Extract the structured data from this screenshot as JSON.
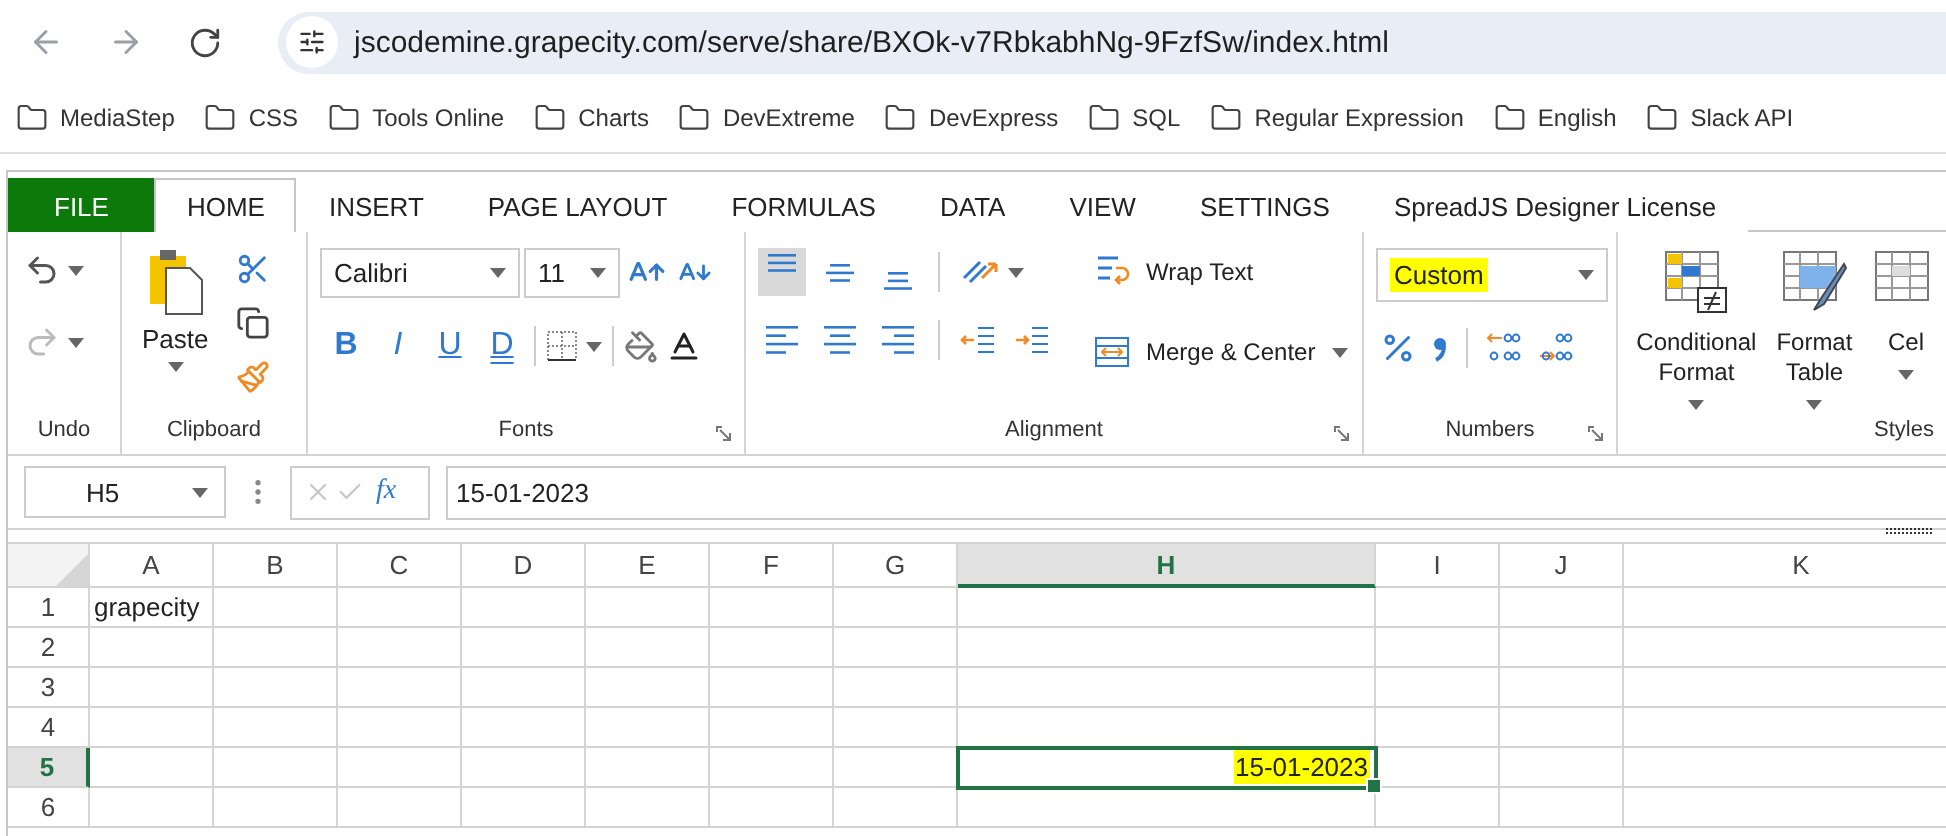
{
  "browser": {
    "url": "jscodemine.grapecity.com/serve/share/BXOk-v7RbkabhNg-9FzfSw/index.html",
    "bookmarks": [
      "MediaStep",
      "CSS",
      "Tools Online",
      "Charts",
      "DevExtreme",
      "DevExpress",
      "SQL",
      "Regular Expression",
      "English",
      "Slack API"
    ]
  },
  "ribbon": {
    "tabs": [
      {
        "label": "FILE",
        "kind": "file",
        "selected": false
      },
      {
        "label": "HOME",
        "kind": "tab",
        "selected": true
      },
      {
        "label": "INSERT",
        "kind": "tab",
        "selected": false
      },
      {
        "label": "PAGE LAYOUT",
        "kind": "tab",
        "selected": false
      },
      {
        "label": "FORMULAS",
        "kind": "tab",
        "selected": false
      },
      {
        "label": "DATA",
        "kind": "tab",
        "selected": false
      },
      {
        "label": "VIEW",
        "kind": "tab",
        "selected": false
      },
      {
        "label": "SETTINGS",
        "kind": "tab",
        "selected": false
      },
      {
        "label": "SpreadJS Designer License",
        "kind": "tab",
        "selected": false
      }
    ],
    "undo": {
      "label": "Undo",
      "buttons": [
        {
          "kind": "undo",
          "disabled": false
        },
        {
          "kind": "redo",
          "disabled": true
        }
      ]
    },
    "clipboard": {
      "label": "Clipboard",
      "paste": "Paste"
    },
    "fonts": {
      "label": "Fonts",
      "font": "Calibri",
      "size": "11",
      "styles": [
        "B",
        "I",
        "U",
        "D"
      ]
    },
    "alignment": {
      "label": "Alignment",
      "vertical": [
        {
          "kind": "top",
          "selected": true
        },
        {
          "kind": "middle",
          "selected": false
        },
        {
          "kind": "bottom",
          "selected": false
        }
      ],
      "horizontal": [
        {
          "kind": "left",
          "selected": false
        },
        {
          "kind": "center",
          "selected": false
        },
        {
          "kind": "right",
          "selected": false
        }
      ],
      "wrap_text": "Wrap Text",
      "merge": "Merge & Center"
    },
    "numbers": {
      "label": "Numbers",
      "format": "Custom",
      "highlighted": true
    },
    "styles": {
      "label": "Styles",
      "buttons": [
        {
          "kind": "conditional",
          "label": "Conditional Format"
        },
        {
          "kind": "table",
          "label": "Format Table"
        },
        {
          "kind": "cell",
          "label": "Cel"
        }
      ]
    }
  },
  "formula_bar": {
    "name_box": "H5",
    "fx": "fx",
    "value": "15-01-2023"
  },
  "sheet": {
    "columns": [
      {
        "label": "A",
        "selected": false
      },
      {
        "label": "B",
        "selected": false
      },
      {
        "label": "C",
        "selected": false
      },
      {
        "label": "D",
        "selected": false
      },
      {
        "label": "E",
        "selected": false
      },
      {
        "label": "F",
        "selected": false
      },
      {
        "label": "G",
        "selected": false
      },
      {
        "label": "H",
        "selected": true
      },
      {
        "label": "I",
        "selected": false
      },
      {
        "label": "J",
        "selected": false
      },
      {
        "label": "K",
        "selected": false
      }
    ],
    "rows": [
      {
        "label": "1",
        "selected": false,
        "cells": [
          {
            "text": "grapecity"
          },
          {},
          {},
          {},
          {},
          {},
          {},
          {},
          {},
          {},
          {}
        ]
      },
      {
        "label": "2",
        "selected": false,
        "cells": [
          {},
          {},
          {},
          {},
          {},
          {},
          {},
          {},
          {},
          {},
          {}
        ]
      },
      {
        "label": "3",
        "selected": false,
        "cells": [
          {},
          {},
          {},
          {},
          {},
          {},
          {},
          {},
          {},
          {},
          {}
        ]
      },
      {
        "label": "4",
        "selected": false,
        "cells": [
          {},
          {},
          {},
          {},
          {},
          {},
          {},
          {},
          {},
          {},
          {}
        ]
      },
      {
        "label": "5",
        "selected": true,
        "cells": [
          {},
          {},
          {},
          {},
          {},
          {},
          {},
          {
            "text": "15-01-2023",
            "kind": "date",
            "highlighted": true
          },
          {},
          {},
          {}
        ]
      },
      {
        "label": "6",
        "selected": false,
        "cells": [
          {},
          {},
          {},
          {},
          {},
          {},
          {},
          {},
          {},
          {},
          {}
        ]
      }
    ]
  }
}
